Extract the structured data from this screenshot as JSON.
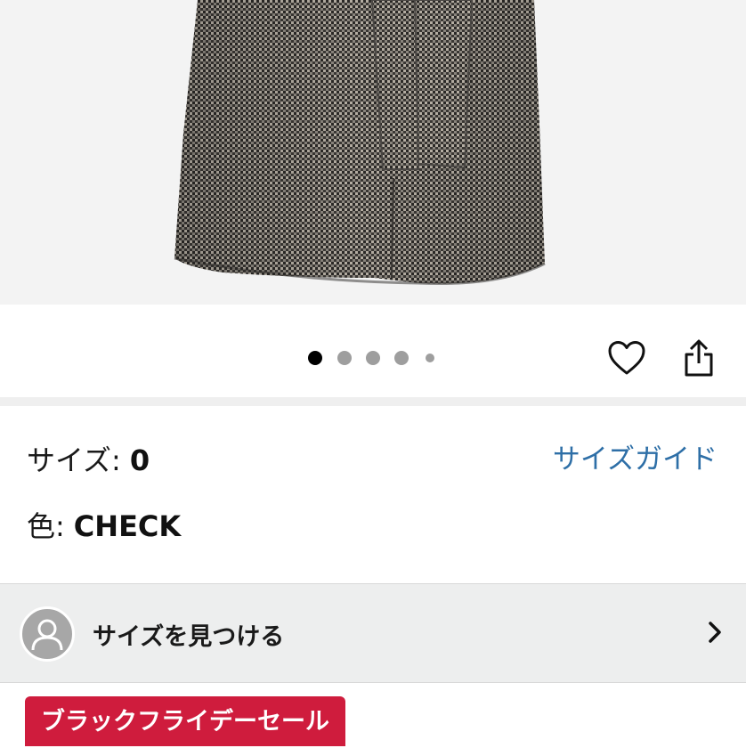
{
  "product_image": {
    "description_icon": "coat-image"
  },
  "carousel": {
    "total": 5,
    "active": 0
  },
  "actions": {
    "favorite_icon": "heart-icon",
    "share_icon": "share-icon"
  },
  "size": {
    "label": "サイズ:",
    "value": "0",
    "guide_link": "サイズガイド"
  },
  "color": {
    "label": "色:",
    "value": "CHECK"
  },
  "find_size": {
    "label": "サイズを見つける",
    "icon": "user-avatar-icon",
    "chevron": "chevron-right-icon"
  },
  "badge": {
    "label": "ブラックフライデーセール",
    "color": "#cf1c3d"
  },
  "colors": {
    "link": "#2e6fa7",
    "accent": "#cf1c3d"
  }
}
